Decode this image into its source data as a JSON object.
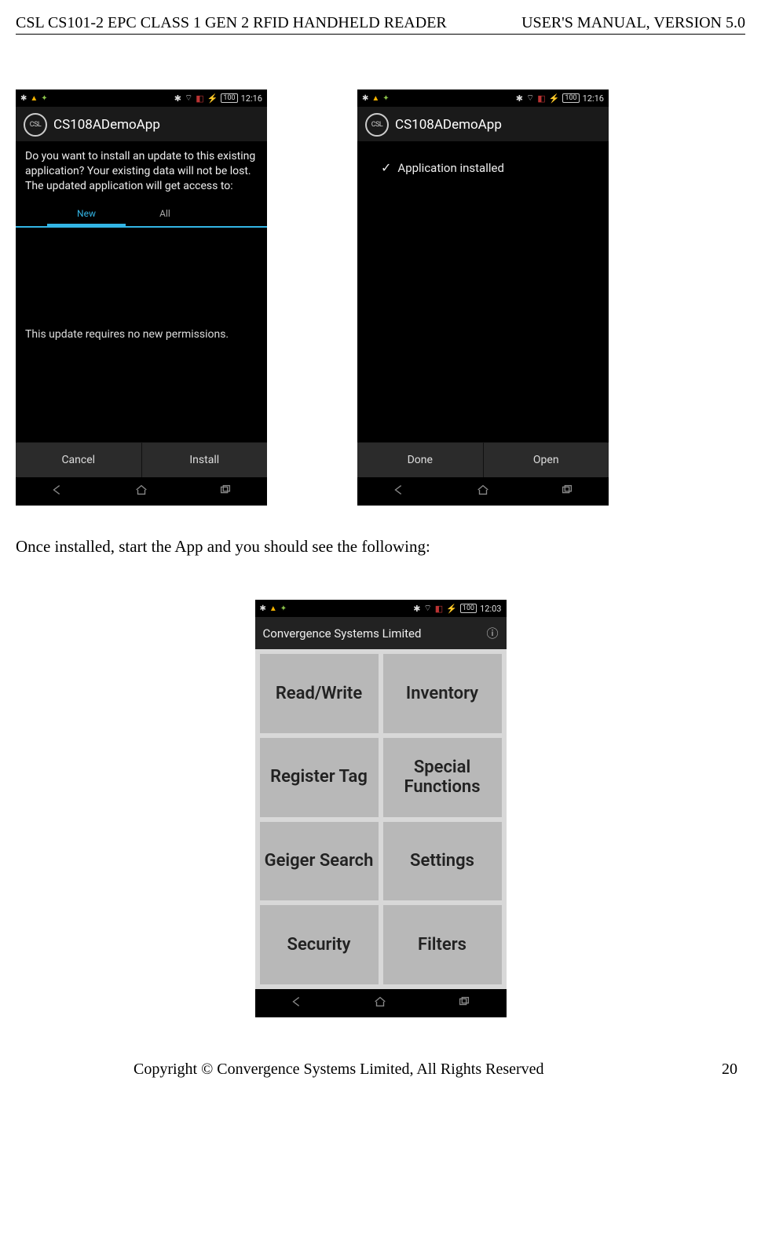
{
  "doc": {
    "header_left": "CSL CS101-2 EPC CLASS 1 GEN 2 RFID HANDHELD READER",
    "header_right": "USER'S  MANUAL,   VERSION  5.0",
    "body_text": "Once installed, start the App and you should see the following:",
    "copyright": "Copyright © Convergence Systems Limited, All Rights Reserved",
    "page_number": "20"
  },
  "phone1": {
    "status_left_icons": [
      "bluetooth-icon",
      "warning-icon",
      "android-icon"
    ],
    "status_right_icons": [
      "bluetooth-icon",
      "wifi-icon",
      "sim-icon",
      "charge-icon"
    ],
    "battery": "100",
    "time": "12:16",
    "app_badge": "CSL",
    "app_title": "CS108ADemoApp",
    "info": "Do you want to install an update to this existing application? Your existing data will not be lost. The updated application will get access to:",
    "tab_new": "New",
    "tab_all": "All",
    "perm": "This update requires no new permissions.",
    "btn_cancel": "Cancel",
    "btn_install": "Install"
  },
  "phone2": {
    "status_left_icons": [
      "bluetooth-icon",
      "warning-icon",
      "android-icon"
    ],
    "status_right_icons": [
      "bluetooth-icon",
      "wifi-icon",
      "sim-icon",
      "charge-icon"
    ],
    "battery": "100",
    "time": "12:16",
    "app_badge": "CSL",
    "app_title": "CS108ADemoApp",
    "installed": "Application installed",
    "btn_done": "Done",
    "btn_open": "Open"
  },
  "phone3": {
    "status_left_icons": [
      "bluetooth-icon",
      "warning-icon",
      "android-icon"
    ],
    "status_right_icons": [
      "bluetooth-icon",
      "wifi-icon",
      "sim-icon",
      "charge-icon"
    ],
    "battery": "100",
    "time": "12:03",
    "title": "Convergence Systems Limited",
    "buttons": [
      "Read/Write",
      "Inventory",
      "Register Tag",
      "Special Functions",
      "Geiger Search",
      "Settings",
      "Security",
      "Filters"
    ]
  }
}
